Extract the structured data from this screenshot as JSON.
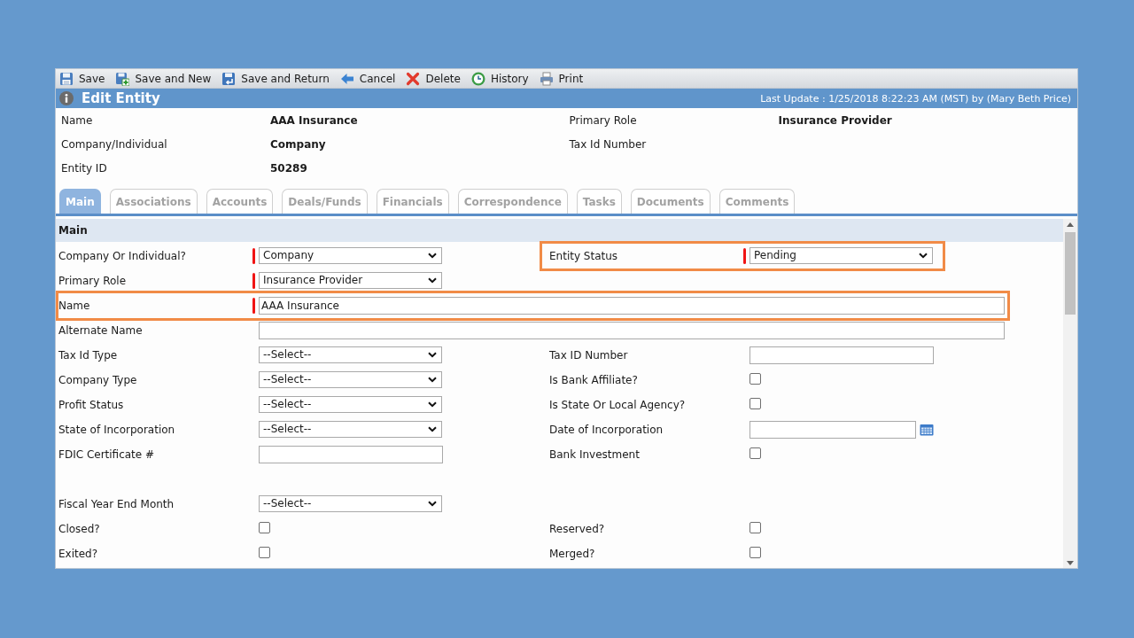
{
  "toolbar": [
    {
      "label": "Save",
      "kind": "save"
    },
    {
      "label": "Save and New",
      "kind": "new"
    },
    {
      "label": "Save and Return",
      "kind": "return"
    },
    {
      "label": "Cancel",
      "kind": "cancel"
    },
    {
      "label": "Delete",
      "kind": "delete"
    },
    {
      "label": "History",
      "kind": "history"
    },
    {
      "label": "Print",
      "kind": "print"
    }
  ],
  "title_bar": {
    "title": "Edit Entity",
    "last_update": "Last Update : 1/25/2018 8:22:23 AM (MST) by (Mary Beth Price)"
  },
  "summary": {
    "rows": [
      {
        "cells": [
          {
            "label": "Name",
            "value": "AAA Insurance"
          },
          {
            "label": "Primary Role",
            "value": "Insurance Provider"
          }
        ]
      },
      {
        "cells": [
          {
            "label": "Company/Individual",
            "value": "Company"
          },
          {
            "label": "Tax Id Number"
          }
        ]
      },
      {
        "cells": [
          {
            "label": "Entity ID",
            "value": "50289"
          }
        ]
      }
    ]
  },
  "tabs": [
    {
      "label": "Main",
      "selected": true
    },
    {
      "label": "Associations",
      "selected": false
    },
    {
      "label": "Accounts",
      "selected": false
    },
    {
      "label": "Deals/Funds",
      "selected": false
    },
    {
      "label": "Financials",
      "selected": false
    },
    {
      "label": "Correspondence",
      "selected": false
    },
    {
      "label": "Tasks",
      "selected": false
    },
    {
      "label": "Documents",
      "selected": false
    },
    {
      "label": "Comments",
      "selected": false
    }
  ],
  "form": {
    "section_title": "Main",
    "rows": [
      {
        "kind": "pair",
        "cells": [
          {
            "label": "Company Or Individual?",
            "kind": "select",
            "value": "Company",
            "required": true,
            "highlighted": false
          },
          {
            "label": "Entity Status",
            "kind": "select",
            "value": "Pending",
            "required": true,
            "highlighted": true
          }
        ]
      },
      {
        "kind": "pair",
        "cells": [
          {
            "label": "Primary Role",
            "kind": "select",
            "value": "Insurance Provider",
            "required": true,
            "highlighted": false
          }
        ]
      },
      {
        "kind": "wide",
        "cells": [
          {
            "label": "Name",
            "kind": "text",
            "value": "AAA Insurance",
            "required": true,
            "highlighted": true
          }
        ]
      },
      {
        "kind": "wide",
        "cells": [
          {
            "label": "Alternate Name",
            "kind": "text",
            "required": false,
            "highlighted": false
          }
        ]
      },
      {
        "kind": "pair",
        "cells": [
          {
            "label": "Tax Id Type",
            "kind": "select",
            "value": "--Select--",
            "required": false,
            "highlighted": false
          },
          {
            "label": "Tax ID Number",
            "kind": "text",
            "required": false,
            "highlighted": false
          }
        ]
      },
      {
        "kind": "pair",
        "cells": [
          {
            "label": "Company Type",
            "kind": "select",
            "value": "--Select--",
            "required": false,
            "highlighted": false
          },
          {
            "label": "Is Bank Affiliate?",
            "kind": "checkbox",
            "checked": false,
            "required": false,
            "highlighted": false
          }
        ]
      },
      {
        "kind": "pair",
        "cells": [
          {
            "label": "Profit Status",
            "kind": "select",
            "value": "--Select--",
            "required": false,
            "highlighted": false
          },
          {
            "label": "Is State Or Local Agency?",
            "kind": "checkbox",
            "checked": false,
            "required": false,
            "highlighted": false
          }
        ]
      },
      {
        "kind": "pair",
        "cells": [
          {
            "label": "State of Incorporation",
            "kind": "select",
            "value": "--Select--",
            "required": false,
            "highlighted": false
          },
          {
            "label": "Date of Incorporation",
            "kind": "date",
            "required": false,
            "highlighted": false
          }
        ]
      },
      {
        "kind": "pair",
        "cells": [
          {
            "label": "FDIC Certificate #",
            "kind": "text",
            "required": false,
            "highlighted": false
          },
          {
            "label": "Bank Investment",
            "kind": "checkbox",
            "checked": false,
            "required": false,
            "highlighted": false
          }
        ]
      },
      {
        "kind": "blank"
      },
      {
        "kind": "pair",
        "cells": [
          {
            "label": "Fiscal Year End Month",
            "kind": "select",
            "value": "--Select--",
            "required": false,
            "highlighted": false
          }
        ]
      },
      {
        "kind": "pair",
        "cells": [
          {
            "label": "Closed?",
            "kind": "checkbox",
            "checked": false,
            "required": false,
            "highlighted": false
          },
          {
            "label": "Reserved?",
            "kind": "checkbox",
            "checked": false,
            "required": false,
            "highlighted": false
          }
        ]
      },
      {
        "kind": "pair",
        "cells": [
          {
            "label": "Exited?",
            "kind": "checkbox",
            "checked": false,
            "required": false,
            "highlighted": false
          },
          {
            "label": "Merged?",
            "kind": "checkbox",
            "checked": false,
            "required": false,
            "highlighted": false
          }
        ]
      }
    ]
  }
}
